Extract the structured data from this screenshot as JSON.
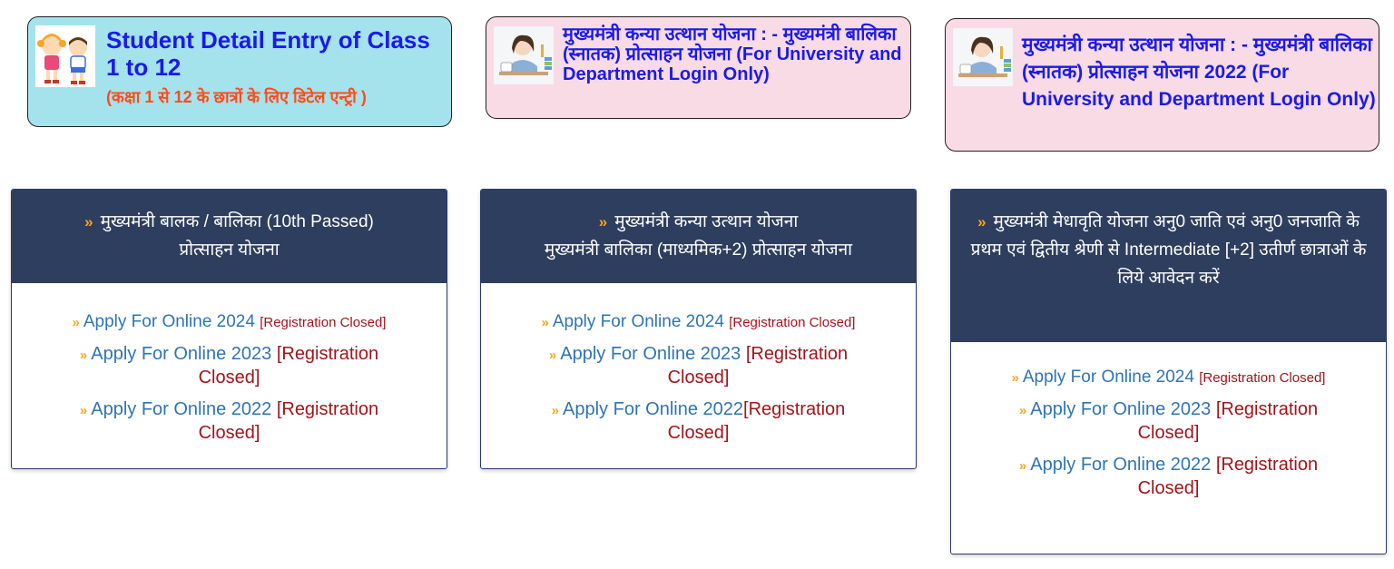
{
  "top_cards": [
    {
      "title": "Student Detail Entry of Class 1 to 12",
      "subtitle": "(कक्षा 1 से 12 के छात्रों के लिए डिटेल एन्ट्री )",
      "thumb_icon": "children-illustration-icon"
    },
    {
      "title": "मुख्यमंत्री कन्या उत्थान योजना : - मुख्यमंत्री बालिका (स्नातक) प्रोत्साहन योजना (For University and Department Login Only)",
      "thumb_icon": "student-girl-illustration-icon"
    },
    {
      "title": "मुख्यमंत्री कन्या उत्थान योजना : - मुख्यमंत्री बालिका (स्नातक) प्रोत्साहन योजना 2022 (For University and Department Login Only)",
      "thumb_icon": "student-girl-illustration-icon"
    }
  ],
  "panels": [
    {
      "heading_line1": "मुख्यमंत्री बालक / बालिका (10th Passed)",
      "heading_line2": "प्रोत्साहन योजना",
      "links": [
        {
          "label": "Apply For Online 2024",
          "status": "[Registration Closed]"
        },
        {
          "label": "Apply For Online 2023",
          "status": "[Registration Closed]"
        },
        {
          "label": "Apply For Online 2022",
          "status": "[Registration Closed]"
        }
      ]
    },
    {
      "heading_line1": "मुख्यमंत्री कन्या उत्थान योजना",
      "heading_line2": "मुख्यमंत्री बालिका (माध्यमिक+2) प्रोत्साहन योजना",
      "links": [
        {
          "label": "Apply For Online 2024",
          "status": "[Registration Closed]"
        },
        {
          "label": "Apply For Online 2023",
          "status": "[Registration Closed]"
        },
        {
          "label": "Apply For Online 2022",
          "status": "[Registration Closed]"
        }
      ]
    },
    {
      "heading_line1": "मुख्यमंत्री मेधावृति योजना अनु0 जाति एवं अनु0 जनजाति के",
      "heading_line2": "प्रथम एवं द्वितीय श्रेणी से Intermediate [+2] उतीर्ण छात्राओं के लिये आवेदन करें",
      "links": [
        {
          "label": "Apply For Online 2024",
          "status": "[Registration Closed]"
        },
        {
          "label": "Apply For Online 2023",
          "status": "[Registration Closed]"
        },
        {
          "label": "Apply For Online 2022",
          "status": "[Registration Closed]"
        }
      ]
    }
  ],
  "colors": {
    "card_blue": "#a4e2ec",
    "card_pink": "#f9dbe5",
    "title_blue": "#1a1aee",
    "subtitle_orange": "#ff4b1a",
    "panel_header": "#2e3e5e",
    "link_blue": "#2f74b5",
    "status_red": "#a0151b",
    "arrow_orange": "#f5a623"
  }
}
